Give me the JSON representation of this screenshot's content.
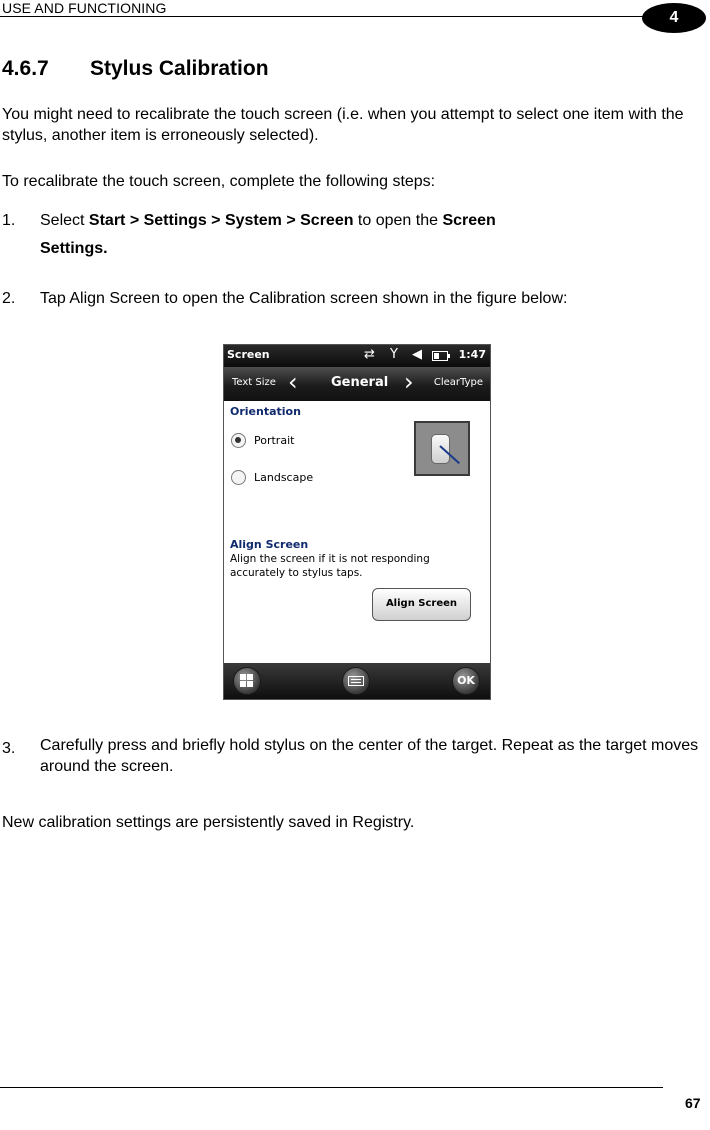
{
  "header": {
    "title": "USE AND FUNCTIONING",
    "chapter": "4"
  },
  "section": {
    "number": "4.6.7",
    "title": "Stylus Calibration"
  },
  "paragraphs": {
    "intro": "You might need to recalibrate the touch screen (i.e. when you attempt to select one item with the stylus, another item is erroneously selected).",
    "lead": "To recalibrate the touch screen, complete the following steps:",
    "closing": "New calibration settings are persistently saved in Registry."
  },
  "steps": {
    "s1": {
      "num": "1.",
      "pre": "Select ",
      "path": "Start > Settings > System > Screen",
      "mid": " to open the ",
      "target_line1": "Screen",
      "target_line2": "Settings."
    },
    "s2": {
      "num": "2.",
      "text": "Tap Align Screen to open the Calibration screen shown in the figure below:"
    },
    "s3": {
      "num": "3.",
      "text": "Carefully press and briefly hold stylus on the center of the target. Repeat as the target moves around the screen."
    }
  },
  "device_screen": {
    "status_title": "Screen",
    "clock": "1:47",
    "status_icons": [
      "sync-icon",
      "signal-off-icon",
      "volume-mute-icon",
      "battery-icon"
    ],
    "tabs": {
      "left": "Text Size",
      "current": "General",
      "right": "ClearType"
    },
    "orientation": {
      "heading": "Orientation",
      "options": [
        {
          "label": "Portrait",
          "selected": true
        },
        {
          "label": "Landscape",
          "selected": false
        }
      ]
    },
    "align": {
      "heading": "Align Screen",
      "description_line1": "Align the screen if it is not responding",
      "description_line2": "accurately to stylus taps.",
      "button": "Align Screen"
    },
    "softkeys": {
      "start_icon": "windows-logo-icon",
      "keyboard_icon": "keyboard-icon",
      "ok": "OK"
    }
  },
  "footer": {
    "page": "67"
  }
}
